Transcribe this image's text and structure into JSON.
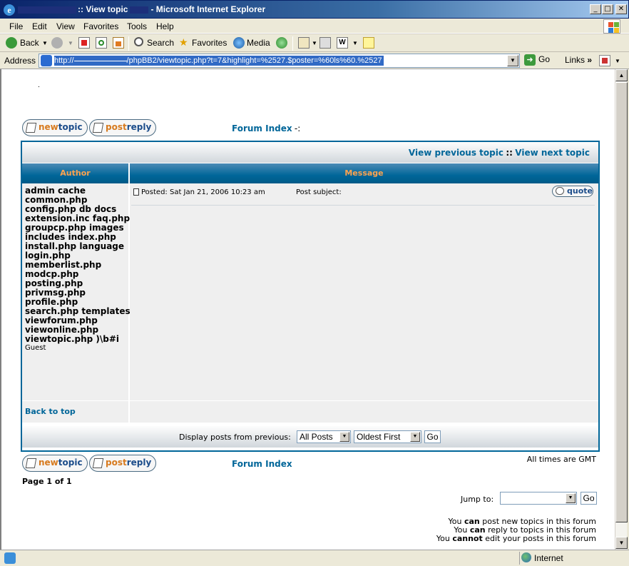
{
  "window": {
    "title": ":: View topic",
    "title_suffix": "- Microsoft Internet Explorer",
    "min": "_",
    "max": "□",
    "close": "✕"
  },
  "menu": [
    "File",
    "Edit",
    "View",
    "Favorites",
    "Tools",
    "Help"
  ],
  "toolbar": {
    "back": "Back",
    "search": "Search",
    "favorites": "Favorites",
    "media": "Media"
  },
  "address": {
    "label": "Address",
    "url_prefix": "http://",
    "url_rest": "/phpBB2/viewtopic.php?t=7&highlight=%2527.$poster=%60ls%60.%2527",
    "go": "Go",
    "links": "Links"
  },
  "status": {
    "zone": "Internet"
  },
  "forum": {
    "newtopic_a": "new",
    "newtopic_b": "topic",
    "postreply_a": "post",
    "postreply_b": "reply",
    "forum_index": "Forum Index",
    "forum_index_sep": "-:",
    "view_previous": "View previous topic",
    "nav_sep": "::",
    "view_next": "View next topic",
    "header_author": "Author",
    "header_message": "Message",
    "author_name": "admin cache\ncommon.php\nconfig.php db docs\nextension.inc faq.php\ngroupcp.php images\nincludes index.php\ninstall.php language\nlogin.php\nmemberlist.php\nmodcp.php\nposting.php\nprivmsg.php\nprofile.php\nsearch.php templates\nviewforum.php\nviewonline.php\nviewtopic.php )\\b#i",
    "author_rank": "Guest",
    "posted": "Posted: Sat Jan 21, 2006 10:23 am",
    "subject": "Post subject:",
    "quote": "quote",
    "back_to_top": "Back to top",
    "display_posts": "Display posts from previous:",
    "all_posts": "All Posts",
    "oldest_first": "Oldest First",
    "go": "Go",
    "timezone": "All times are GMT",
    "page_of": "Page 1 of 1",
    "jump_to": "Jump to:",
    "jump_go": "Go",
    "perm_1_a": "You",
    "perm_1_b": "can",
    "perm_1_c": "post new topics in this forum",
    "perm_2_a": "You",
    "perm_2_b": "can",
    "perm_2_c": "reply to topics in this forum",
    "perm_3_a": "You",
    "perm_3_b": "cannot",
    "perm_3_c": "edit your posts in this forum"
  }
}
